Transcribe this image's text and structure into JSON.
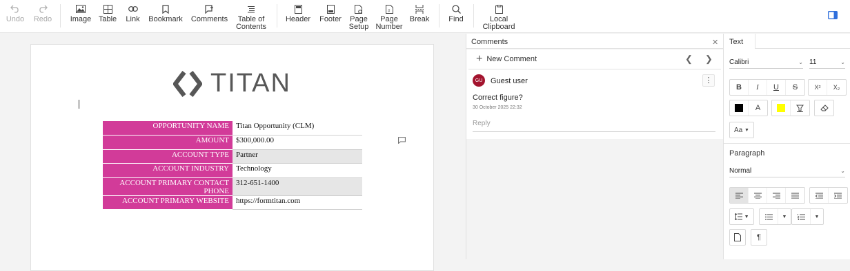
{
  "toolbar": {
    "undo": "Undo",
    "redo": "Redo",
    "image": "Image",
    "table": "Table",
    "link": "Link",
    "bookmark": "Bookmark",
    "comments": "Comments",
    "toc": "Table of\nContents",
    "header": "Header",
    "footer": "Footer",
    "page_setup": "Page\nSetup",
    "page_number": "Page\nNumber",
    "break": "Break",
    "find": "Find",
    "local_clipboard": "Local\nClipboard"
  },
  "document": {
    "logo_text": "TITAN",
    "table": [
      {
        "label": "OPPORTUNITY NAME",
        "value": "Titan Opportunity (CLM)"
      },
      {
        "label": "AMOUNT",
        "value": "$300,000.00"
      },
      {
        "label": "ACCOUNT TYPE",
        "value": "Partner"
      },
      {
        "label": "ACCOUNT INDUSTRY",
        "value": "Technology"
      },
      {
        "label": "ACCOUNT PRIMARY CONTACT PHONE",
        "value": "312-651-1400"
      },
      {
        "label": "ACCOUNT PRIMARY WEBSITE",
        "value": "https://formtitan.com"
      }
    ]
  },
  "comments": {
    "title": "Comments",
    "new_comment": "New Comment",
    "author_initials": "GU",
    "author": "Guest user",
    "text": "Correct figure?",
    "timestamp": "30 October 2025 22:32",
    "reply_placeholder": "Reply"
  },
  "format": {
    "tab_text": "Text",
    "font_family": "Calibri",
    "font_size": "11",
    "bold": "B",
    "italic": "I",
    "underline": "U",
    "strike": "S",
    "superscript": "X²",
    "subscript": "X₂",
    "font_color_letter": "A",
    "case": "Aa",
    "paragraph_label": "Paragraph",
    "paragraph_style": "Normal",
    "pilcrow": "¶"
  },
  "colors": {
    "accent_magenta": "#d23b99",
    "avatar": "#a3142e",
    "font_color": "#000000",
    "highlight": "#ffff00",
    "sidebar_toggle": "#2f6fdc"
  }
}
